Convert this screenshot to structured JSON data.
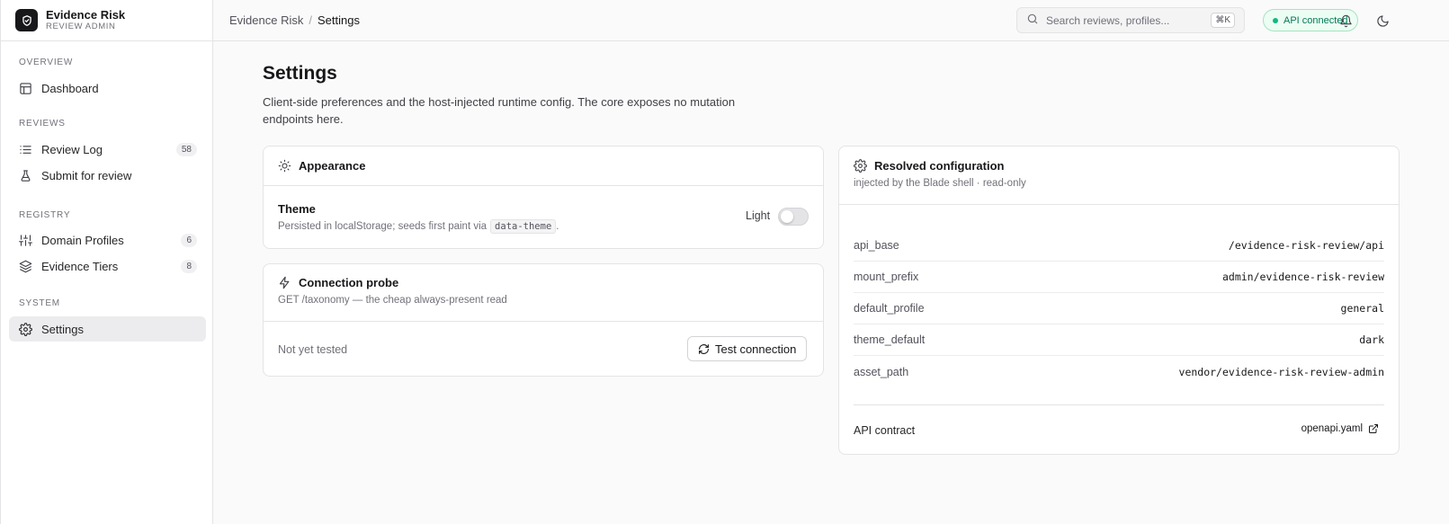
{
  "brand": {
    "title": "Evidence Risk",
    "subtitle": "REVIEW ADMIN"
  },
  "sidebar": {
    "sections": [
      {
        "label": "OVERVIEW"
      },
      {
        "label": "REVIEWS"
      },
      {
        "label": "REGISTRY"
      },
      {
        "label": "SYSTEM"
      }
    ],
    "items": [
      {
        "label": "Dashboard",
        "icon": "layout-icon"
      },
      {
        "label": "Review Log",
        "icon": "list-icon",
        "count": "58"
      },
      {
        "label": "Submit for review",
        "icon": "flask-icon"
      },
      {
        "label": "Domain Profiles",
        "icon": "sliders-icon",
        "count": "6"
      },
      {
        "label": "Evidence Tiers",
        "icon": "layers-icon",
        "count": "8"
      },
      {
        "label": "Settings",
        "icon": "gear-icon",
        "active": true
      }
    ]
  },
  "topbar": {
    "breadcrumb": {
      "root": "Evidence Risk",
      "separator": "/",
      "current": "Settings"
    },
    "search": {
      "placeholder": "Search reviews, profiles...",
      "shortcut": "⌘K"
    },
    "status": {
      "label": "API connected",
      "color": "#10b981"
    }
  },
  "page": {
    "title": "Settings",
    "description": "Client-side preferences and the host-injected runtime config. The core exposes no mutation endpoints here."
  },
  "appearance": {
    "title": "Appearance",
    "theme_label": "Theme",
    "theme_desc": "Persisted in localStorage; seeds first paint via",
    "theme_attr": "data-theme",
    "theme_desc_end": ".",
    "toggle_label": "Light",
    "toggle_on": false
  },
  "probe": {
    "title": "Connection probe",
    "subtitle": "GET /taxonomy — the cheap always-present read",
    "status": "Not yet tested",
    "button": "Test connection"
  },
  "config": {
    "title": "Resolved configuration",
    "subtitle": "injected by the Blade shell · read-only",
    "rows": [
      {
        "key": "api_base",
        "value": "/evidence-risk-review/api"
      },
      {
        "key": "mount_prefix",
        "value": "admin/evidence-risk-review"
      },
      {
        "key": "default_profile",
        "value": "general"
      },
      {
        "key": "theme_default",
        "value": "dark"
      },
      {
        "key": "asset_path",
        "value": "vendor/evidence-risk-review-admin"
      }
    ],
    "contract_label": "API contract",
    "contract_link": "openapi.yaml"
  }
}
